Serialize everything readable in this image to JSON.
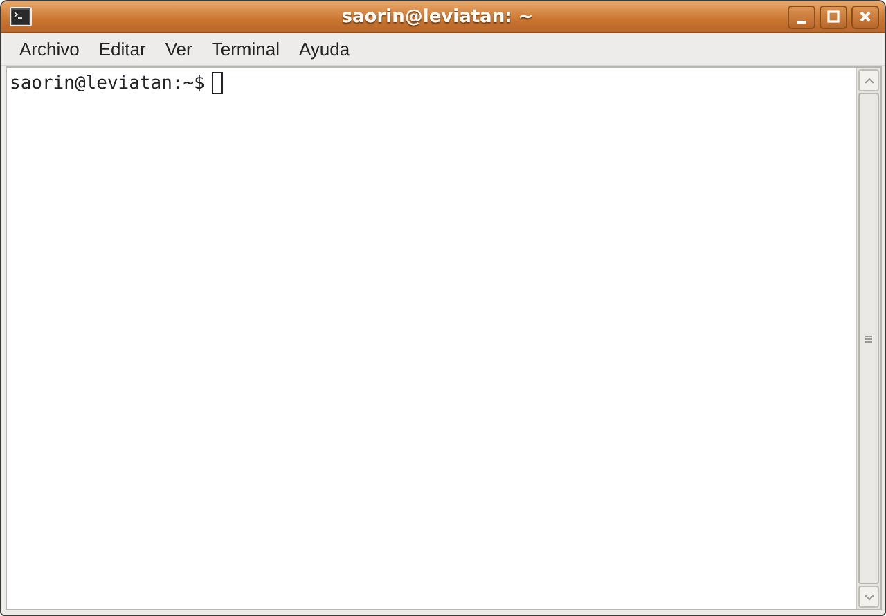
{
  "window": {
    "title": "saorin@leviatan: ~"
  },
  "menu": [
    {
      "label": "Archivo"
    },
    {
      "label": "Editar"
    },
    {
      "label": "Ver"
    },
    {
      "label": "Terminal"
    },
    {
      "label": "Ayuda"
    }
  ],
  "terminal": {
    "prompt": "saorin@leviatan:~$"
  }
}
